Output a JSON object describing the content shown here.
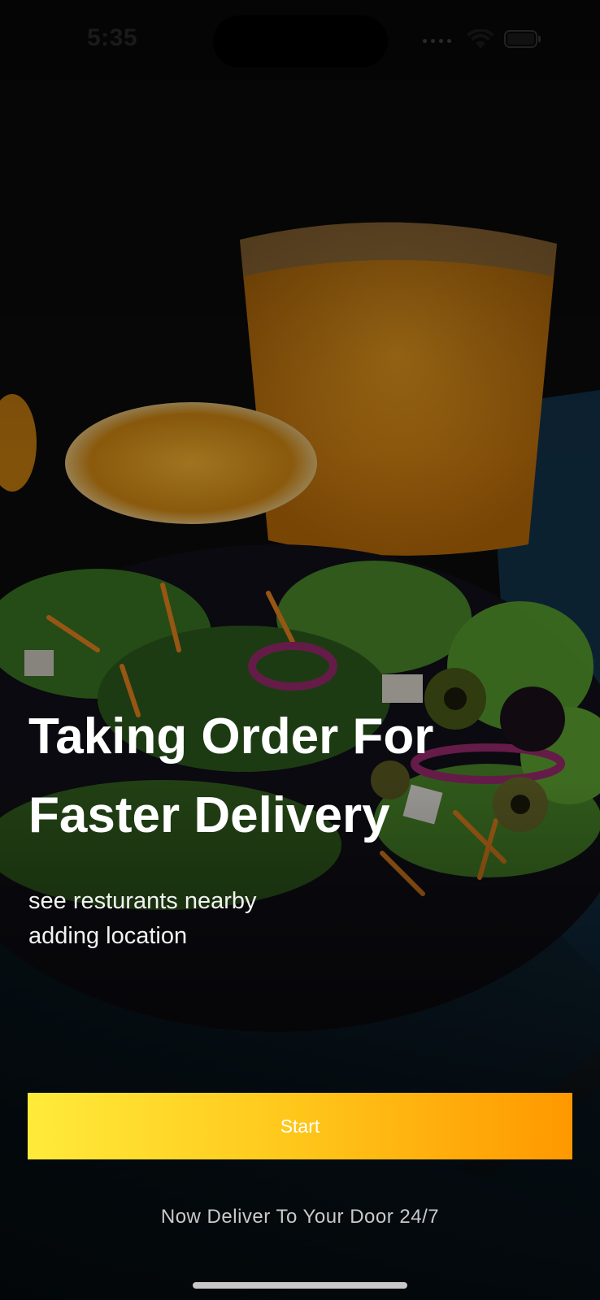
{
  "status_bar": {
    "time": "5:35"
  },
  "hero": {
    "title_line1": "Taking Order For",
    "title_line2": "Faster Delivery",
    "subtitle_line1": "see resturants nearby",
    "subtitle_line2": "adding location"
  },
  "actions": {
    "start_label": "Start"
  },
  "footer": {
    "tagline": "Now Deliver To Your Door 24/7"
  },
  "colors": {
    "button_gradient_start": "#ffeb3b",
    "button_gradient_end": "#ff9800",
    "text_primary": "#ffffff"
  },
  "icons": {
    "wifi": "wifi-icon",
    "battery": "battery-icon",
    "signal": "cellular-signal-icon"
  }
}
